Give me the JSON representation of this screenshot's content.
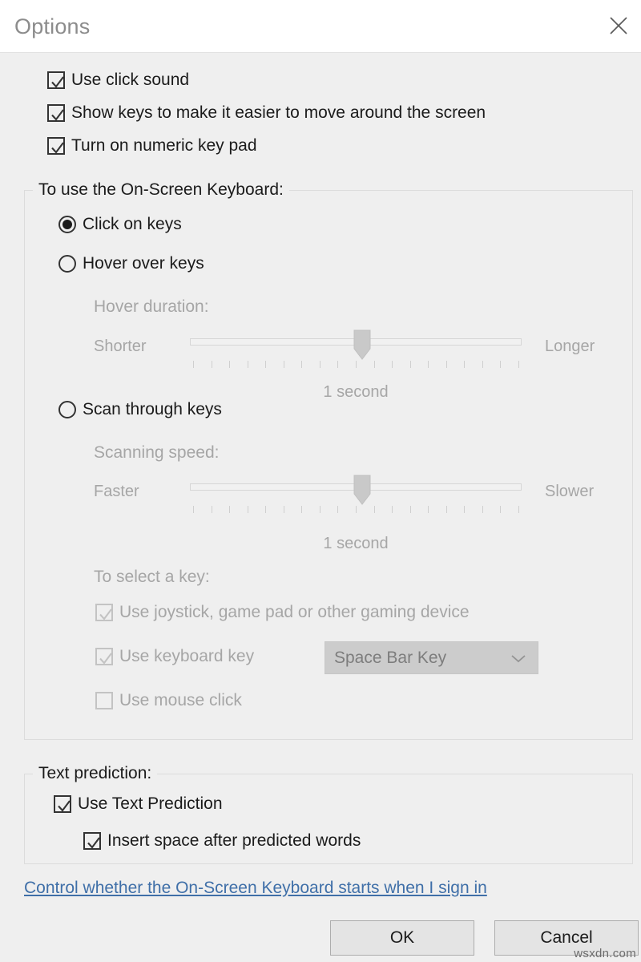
{
  "window": {
    "title": "Options",
    "close_icon": "close-icon"
  },
  "top_checkboxes": [
    {
      "label": "Use click sound",
      "checked": true,
      "disabled": false
    },
    {
      "label": "Show keys to make it easier to move around the screen",
      "checked": true,
      "disabled": false
    },
    {
      "label": "Turn on numeric key pad",
      "checked": true,
      "disabled": false
    }
  ],
  "keyboard_group": {
    "legend": "To use the On-Screen Keyboard:",
    "radios": [
      {
        "label": "Click on keys",
        "selected": true
      },
      {
        "label": "Hover over keys",
        "selected": false
      },
      {
        "label": "Scan through keys",
        "selected": false
      }
    ],
    "hover": {
      "heading": "Hover duration:",
      "min_label": "Shorter",
      "max_label": "Longer",
      "value_label": "1 second",
      "tick_count": 19,
      "thumb_position_percent": 52
    },
    "scanning": {
      "heading": "Scanning speed:",
      "min_label": "Faster",
      "max_label": "Slower",
      "value_label": "1 second",
      "tick_count": 19,
      "thumb_position_percent": 52
    },
    "select_key": {
      "heading": "To select a key:",
      "options": [
        {
          "label": "Use joystick, game pad or other gaming device",
          "checked": true,
          "disabled": true
        },
        {
          "label": "Use keyboard key",
          "checked": true,
          "disabled": true
        },
        {
          "label": "Use mouse click",
          "checked": false,
          "disabled": true
        }
      ],
      "dropdown": {
        "value": "Space Bar Key",
        "disabled": true,
        "arrow_icon": "chevron-down-icon"
      }
    }
  },
  "text_prediction_group": {
    "legend": "Text prediction:",
    "options": [
      {
        "label": "Use Text Prediction",
        "checked": true,
        "disabled": false
      },
      {
        "label": "Insert space after predicted words",
        "checked": true,
        "disabled": false
      }
    ]
  },
  "footer": {
    "link": "Control whether the On-Screen Keyboard starts when I sign in",
    "ok_label": "OK",
    "cancel_label": "Cancel"
  },
  "watermark": "wsxdn.com",
  "colors": {
    "dialog_bg": "#efefef",
    "titlebar_bg": "#ffffff",
    "title_text": "#8c8c8c",
    "body_text": "#1b1b1b",
    "disabled_text": "#a6a6a6",
    "link": "#3f6fa8",
    "button_bg": "#e4e4e4",
    "combo_bg": "#cccccc",
    "groupbox_border": "#dcdcdc"
  }
}
